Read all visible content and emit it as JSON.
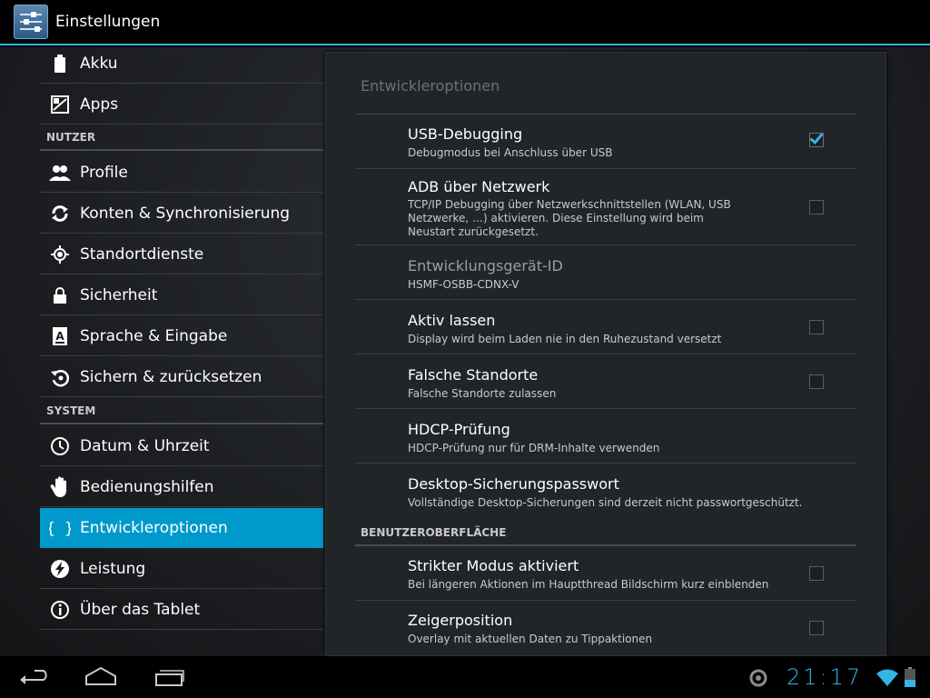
{
  "app": {
    "title": "Einstellungen",
    "icon": "settings-icon"
  },
  "sidebar": {
    "items": [
      {
        "label": "Akku",
        "icon": "battery-icon"
      },
      {
        "label": "Apps",
        "icon": "apps-icon"
      },
      {
        "label": "Profile",
        "icon": "profile-icon"
      },
      {
        "label": "Konten & Synchronisierung",
        "icon": "sync-icon"
      },
      {
        "label": "Standortdienste",
        "icon": "location-icon"
      },
      {
        "label": "Sicherheit",
        "icon": "lock-icon"
      },
      {
        "label": "Sprache & Eingabe",
        "icon": "language-icon"
      },
      {
        "label": "Sichern & zurücksetzen",
        "icon": "backup-icon"
      },
      {
        "label": "Datum & Uhrzeit",
        "icon": "clock-icon"
      },
      {
        "label": "Bedienungshilfen",
        "icon": "hand-icon"
      },
      {
        "label": "Entwickleroptionen",
        "icon": "braces-icon",
        "selected": true
      },
      {
        "label": "Leistung",
        "icon": "performance-icon"
      },
      {
        "label": "Über das Tablet",
        "icon": "info-icon"
      }
    ],
    "headers": {
      "user": "NUTZER",
      "system": "SYSTEM"
    }
  },
  "panel": {
    "title": "Entwickleroptionen",
    "prefs": [
      {
        "title": "USB-Debugging",
        "summary": "Debugmodus bei Anschluss über USB",
        "checked": true
      },
      {
        "title": "ADB über Netzwerk",
        "summary": "TCP/IP Debugging über Netzwerkschnittstellen (WLAN, USB Netzwerke, …) aktivieren. Diese Einstellung wird beim Neustart zurückgesetzt.",
        "checked": false
      },
      {
        "title": "Entwicklungsgerät-ID",
        "summary": "HSMF-OSBB-CDNX-V"
      },
      {
        "title": "Aktiv lassen",
        "summary": "Display wird beim Laden nie in den Ruhezustand versetzt",
        "checked": false
      },
      {
        "title": "Falsche Standorte",
        "summary": "Falsche Standorte zulassen",
        "checked": false
      },
      {
        "title": "HDCP-Prüfung",
        "summary": "HDCP-Prüfung nur für DRM-Inhalte verwenden"
      },
      {
        "title": "Desktop-Sicherungspasswort",
        "summary": "Vollständige Desktop-Sicherungen sind derzeit nicht passwortgeschützt."
      },
      {
        "title": "Strikter Modus aktiviert",
        "summary": "Bei längeren Aktionen im Hauptthread Bildschirm kurz einblenden",
        "checked": false
      },
      {
        "title": "Zeigerposition",
        "summary": "Overlay mit aktuellen Daten zu Tippaktionen",
        "checked": false
      }
    ],
    "section_ui": "BENUTZEROBERFLÄCHE"
  },
  "statusbar": {
    "time": "21:17"
  },
  "colors": {
    "accent": "#33b5e5",
    "selected": "#0099cc"
  }
}
